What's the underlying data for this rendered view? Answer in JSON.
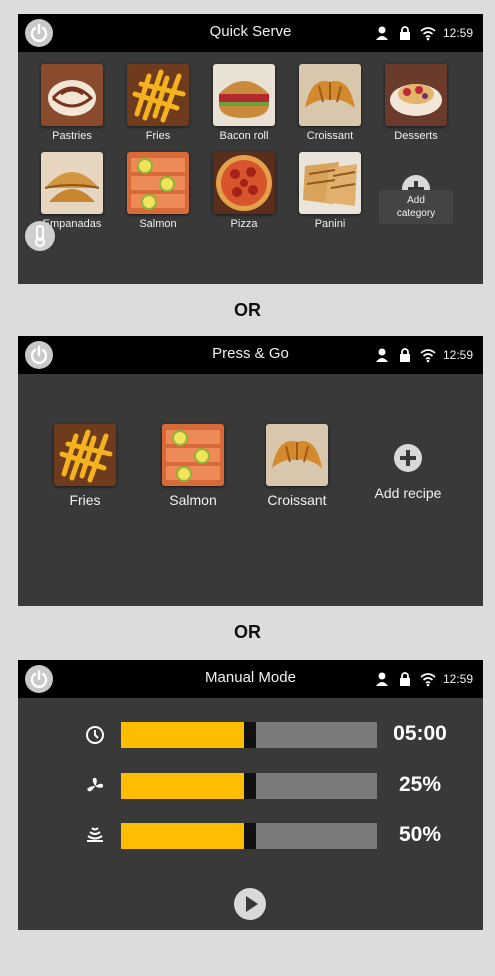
{
  "separators": [
    "OR",
    "OR"
  ],
  "status": {
    "time": "12:59",
    "icons": [
      "person-icon",
      "lock-icon",
      "wifi-icon"
    ]
  },
  "quick_serve": {
    "title": "Quick Serve",
    "items": [
      {
        "label": "Pastries",
        "icon": "pastries-image"
      },
      {
        "label": "Fries",
        "icon": "fries-image"
      },
      {
        "label": "Bacon roll",
        "icon": "bacon-roll-image"
      },
      {
        "label": "Croissant",
        "icon": "croissant-image"
      },
      {
        "label": "Desserts",
        "icon": "desserts-image"
      },
      {
        "label": "Empanadas",
        "icon": "empanadas-image"
      },
      {
        "label": "Salmon",
        "icon": "salmon-image"
      },
      {
        "label": "Pizza",
        "icon": "pizza-image"
      },
      {
        "label": "Panini",
        "icon": "panini-image"
      }
    ],
    "add_category_line1": "Add",
    "add_category_line2": "category"
  },
  "press_go": {
    "title": "Press & Go",
    "items": [
      {
        "label": "Fries",
        "icon": "fries-image"
      },
      {
        "label": "Salmon",
        "icon": "salmon-image"
      },
      {
        "label": "Croissant",
        "icon": "croissant-image"
      }
    ],
    "add_recipe": "Add recipe"
  },
  "manual": {
    "title": "Manual Mode",
    "rows": [
      {
        "icon": "clock-icon",
        "value": "05:00",
        "level": 0.48
      },
      {
        "icon": "fan-icon",
        "value": "25%",
        "level": 0.48
      },
      {
        "icon": "steam-icon",
        "value": "50%",
        "level": 0.48
      }
    ]
  },
  "colors": {
    "accent": "#ffbd00",
    "panel": "#393939",
    "topbar": "#000000",
    "background": "#dcdcdc",
    "track": "#7a7a7a"
  }
}
